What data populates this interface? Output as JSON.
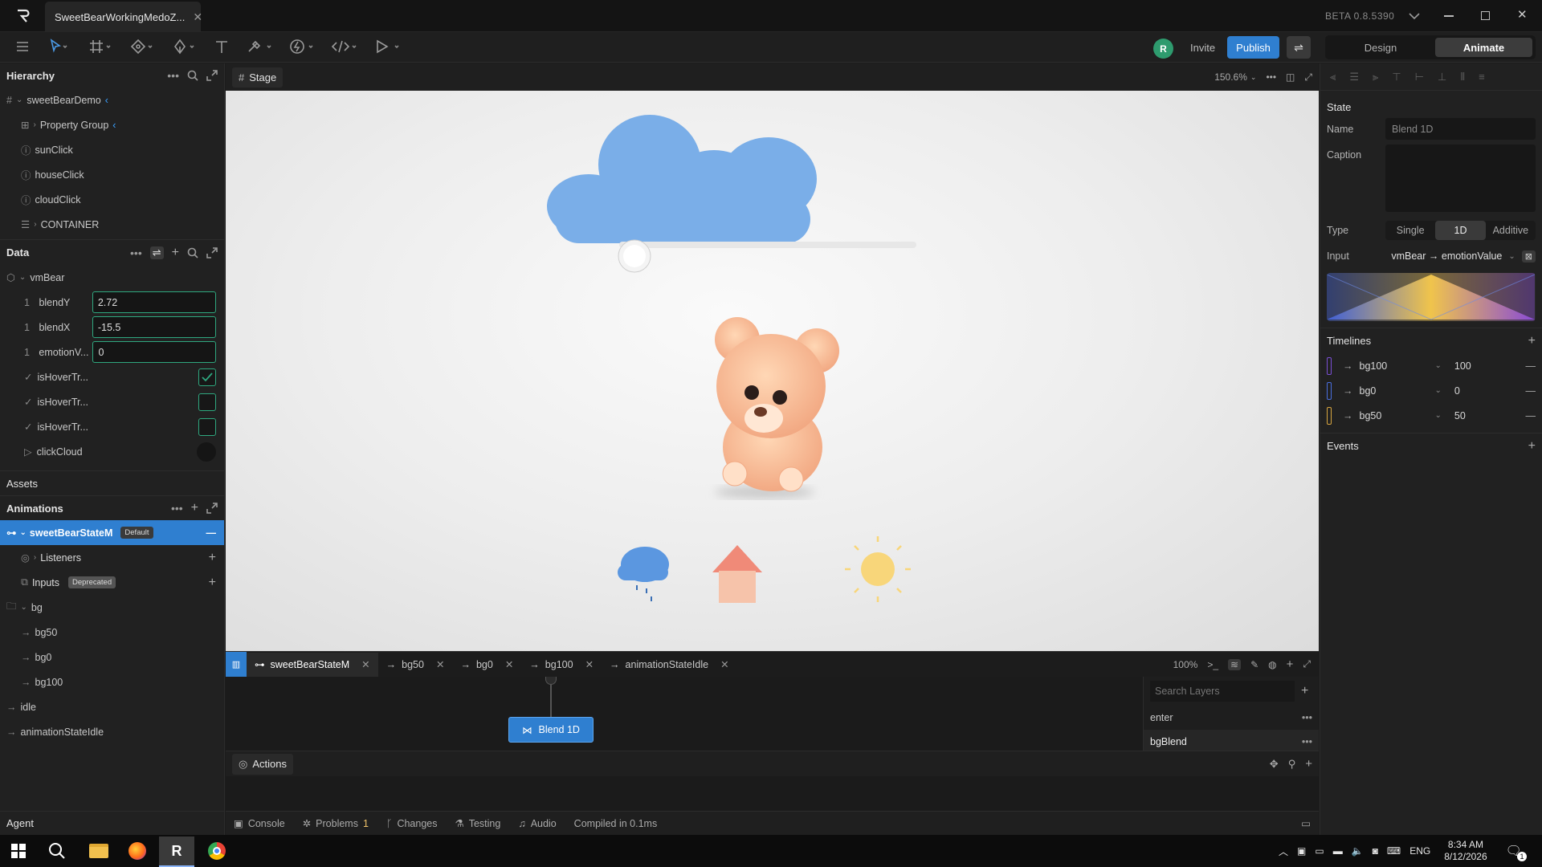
{
  "titlebar": {
    "tab_title": "SweetBearWorkingMedoZ...",
    "version": "BETA 0.8.5390"
  },
  "header": {
    "avatar_letter": "R",
    "invite_label": "Invite",
    "publish_label": "Publish",
    "mode_design": "Design",
    "mode_animate": "Animate"
  },
  "hierarchy": {
    "title": "Hierarchy",
    "items": [
      {
        "label": "sweetBearDemo"
      },
      {
        "label": "Property Group"
      },
      {
        "label": "sunClick"
      },
      {
        "label": "houseClick"
      },
      {
        "label": "cloudClick"
      },
      {
        "label": "CONTAINER"
      }
    ]
  },
  "data_panel": {
    "title": "Data",
    "root": "vmBear",
    "fields": [
      {
        "label": "blendY",
        "value": "2.72"
      },
      {
        "label": "blendX",
        "value": "-15.5"
      },
      {
        "label": "emotionV...",
        "value": "0"
      }
    ],
    "booleans": [
      {
        "label": "isHoverTr...",
        "checked": true
      },
      {
        "label": "isHoverTr...",
        "checked": false
      },
      {
        "label": "isHoverTr...",
        "checked": false
      }
    ],
    "trigger": "clickCloud",
    "num_prefix": "1",
    "check_prefix": "✓"
  },
  "assets": {
    "title": "Assets"
  },
  "animations": {
    "title": "Animations",
    "machine": "sweetBearStateM",
    "default_badge": "Default",
    "listeners": "Listeners",
    "inputs": "Inputs",
    "deprecated_badge": "Deprecated",
    "folder": "bg",
    "folder_items": [
      "bg50",
      "bg0",
      "bg100"
    ],
    "root_items": [
      "idle",
      "animationStateIdle"
    ]
  },
  "agent": {
    "title": "Agent"
  },
  "stage": {
    "tab": "Stage",
    "zoom": "150.6%"
  },
  "bottom_tabs": {
    "items": [
      "sweetBearStateM",
      "bg50",
      "bg0",
      "bg100",
      "animationStateIdle"
    ],
    "zoom": "100%"
  },
  "graph": {
    "node_label": "Blend 1D"
  },
  "layers": {
    "search_placeholder": "Search Layers",
    "items": [
      "enter",
      "bgBlend"
    ]
  },
  "actions": {
    "title": "Actions"
  },
  "status_bar": {
    "console": "Console",
    "problems": "Problems",
    "problems_count": "1",
    "changes": "Changes",
    "testing": "Testing",
    "audio": "Audio",
    "compiled": "Compiled in 0.1ms"
  },
  "state_panel": {
    "title": "State",
    "name_label": "Name",
    "name_value": "Blend 1D",
    "caption_label": "Caption",
    "type_label": "Type",
    "type_options": [
      "Single",
      "1D",
      "Additive"
    ],
    "type_selected": "1D",
    "input_label": "Input",
    "input_value": "vmBear → emotionValue"
  },
  "timelines": {
    "title": "Timelines",
    "items": [
      {
        "name": "bg100",
        "value": "100",
        "color": "#7b4fd6"
      },
      {
        "name": "bg0",
        "value": "0",
        "color": "#4a6fe0"
      },
      {
        "name": "bg50",
        "value": "50",
        "color": "#d9a640"
      }
    ]
  },
  "events": {
    "title": "Events"
  },
  "taskbar": {
    "lang": "ENG",
    "time": "8:34 AM",
    "date": "8/12/2026",
    "notif_count": "1"
  },
  "colors": {
    "accent_blue": "#2f7fd0",
    "accent_green": "#2fa87f"
  }
}
